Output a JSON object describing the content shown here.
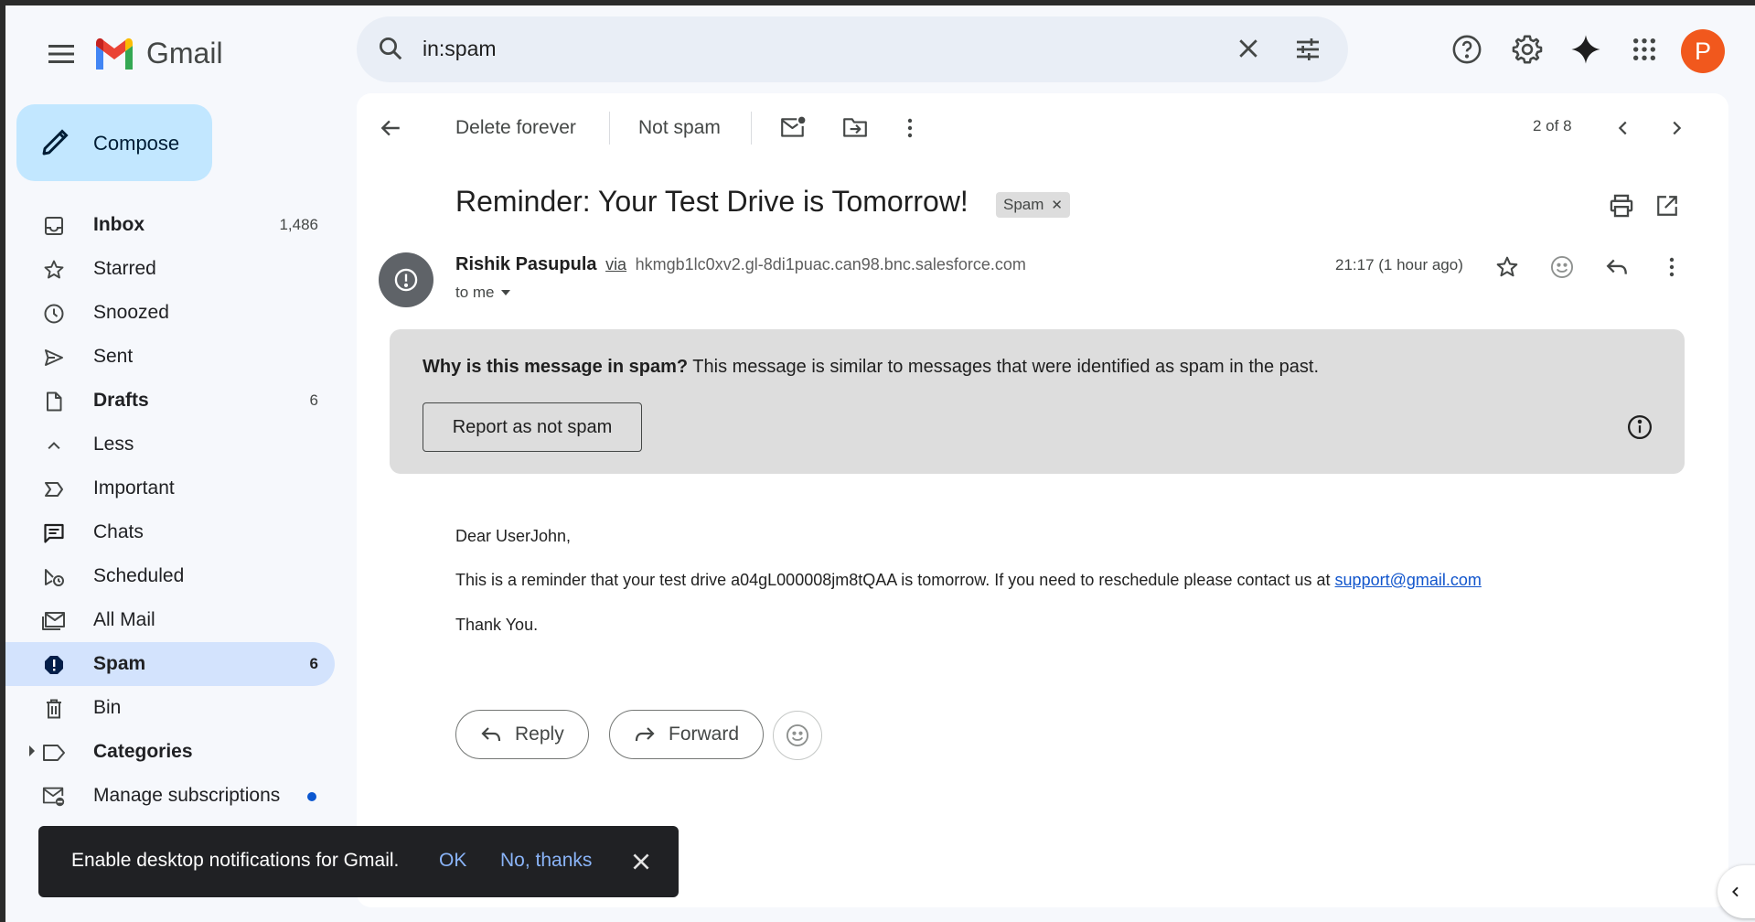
{
  "app": {
    "name": "Gmail",
    "avatar_letter": "P",
    "avatar_color": "#f1581d"
  },
  "search": {
    "value": "in:spam"
  },
  "compose": {
    "label": "Compose"
  },
  "sidebar": {
    "items": [
      {
        "label": "Inbox",
        "count": "1,486",
        "icon": "inbox-icon"
      },
      {
        "label": "Starred",
        "count": "",
        "icon": "star-icon"
      },
      {
        "label": "Snoozed",
        "count": "",
        "icon": "clock-icon"
      },
      {
        "label": "Sent",
        "count": "",
        "icon": "send-icon"
      },
      {
        "label": "Drafts",
        "count": "6",
        "icon": "draft-icon"
      },
      {
        "label": "Less",
        "count": "",
        "icon": "chevron-up-icon"
      },
      {
        "label": "Important",
        "count": "",
        "icon": "important-icon"
      },
      {
        "label": "Chats",
        "count": "",
        "icon": "chat-icon"
      },
      {
        "label": "Scheduled",
        "count": "",
        "icon": "scheduled-send-icon"
      },
      {
        "label": "All Mail",
        "count": "",
        "icon": "all-mail-icon"
      },
      {
        "label": "Spam",
        "count": "6",
        "icon": "spam-icon"
      },
      {
        "label": "Bin",
        "count": "",
        "icon": "trash-icon"
      },
      {
        "label": "Categories",
        "count": "",
        "icon": "label-icon"
      },
      {
        "label": "Manage subscriptions",
        "count": "",
        "icon": "unsubscribe-icon"
      }
    ]
  },
  "toolbar": {
    "delete_forever": "Delete forever",
    "not_spam": "Not spam",
    "pager": "2 of 8"
  },
  "message": {
    "subject": "Reminder: Your Test Drive is Tomorrow!",
    "tag": "Spam",
    "sender_name": "Rishik Pasupula",
    "via": "via",
    "sender_domain": "hkmgb1lc0xv2.gl-8di1puac.can98.bnc.salesforce.com",
    "to": "to me",
    "time": "21:17 (1 hour ago)",
    "spam_why_bold": "Why is this message in spam?",
    "spam_why_text": "This message is similar to messages that were identified as spam in the past.",
    "report_button": "Report as not spam",
    "greeting": "Dear UserJohn,",
    "body": "This is a reminder that your test drive a04gL000008jm8tQAA is tomorrow. If you need to reschedule please contact us at",
    "link": "support@gmail.com",
    "closing": "Thank You."
  },
  "actions": {
    "reply": "Reply",
    "forward": "Forward"
  },
  "snackbar": {
    "message": "Enable desktop notifications for Gmail.",
    "ok": "OK",
    "no_thanks": "No, thanks"
  }
}
